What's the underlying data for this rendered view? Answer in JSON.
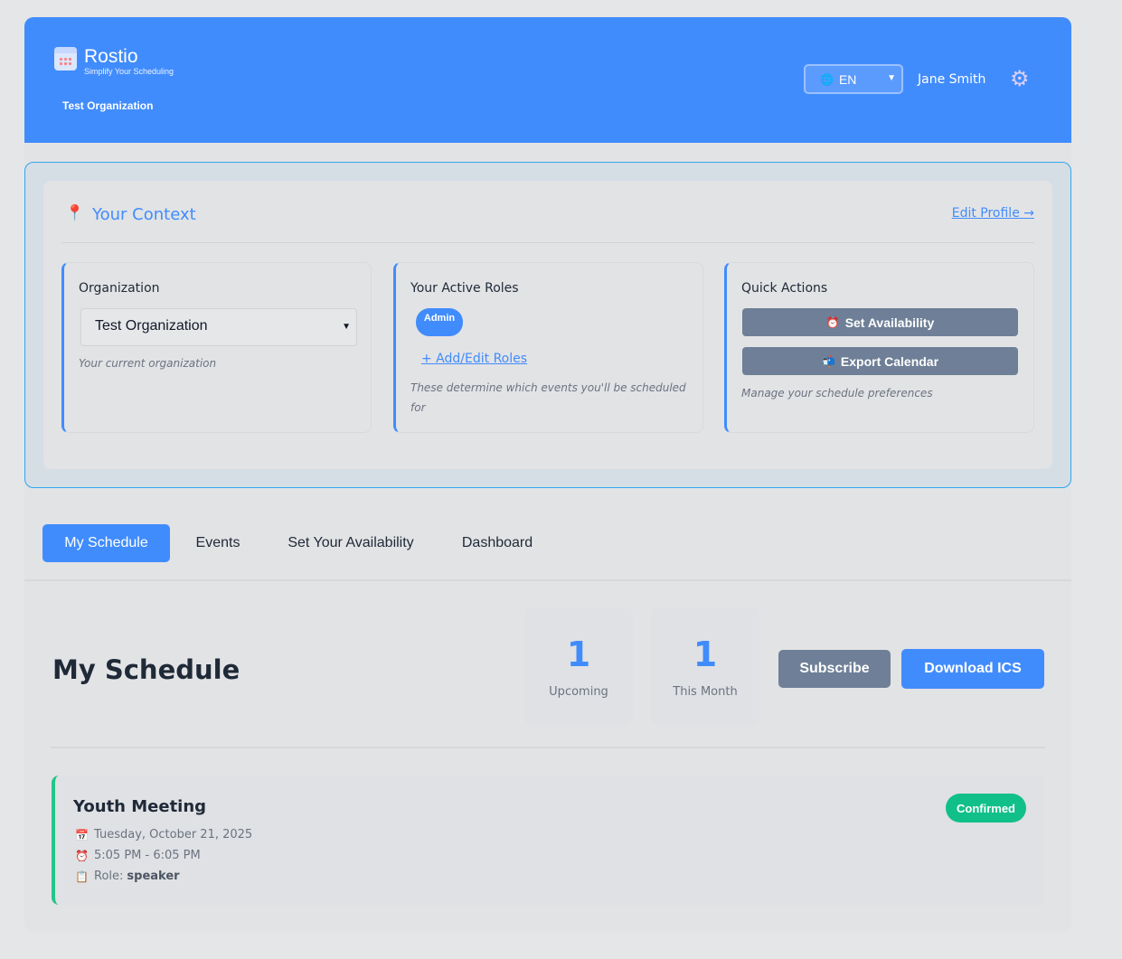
{
  "header": {
    "brand": "Rostio",
    "tagline": "Simplify Your Scheduling",
    "organization": "Test Organization",
    "language": "EN",
    "user_name": "Jane Smith"
  },
  "context": {
    "title": "Your Context",
    "edit_profile": "Edit Profile →",
    "organization_card": {
      "label": "Organization",
      "selected": "Test Organization",
      "note": "Your current organization"
    },
    "roles_card": {
      "label": "Your Active Roles",
      "roles": [
        "Admin"
      ],
      "edit_link": "+ Add/Edit Roles",
      "note_line1": "These determine which events you'll be scheduled",
      "note_line2": "for"
    },
    "quick_actions": {
      "label": "Quick Actions",
      "set_availability": "Set Availability",
      "export_calendar": "Export Calendar",
      "note": "Manage your schedule preferences"
    }
  },
  "tabs": [
    "My Schedule",
    "Events",
    "Set Your Availability",
    "Dashboard"
  ],
  "schedule": {
    "title": "My Schedule",
    "stats": [
      {
        "value": "1",
        "label": "Upcoming"
      },
      {
        "value": "1",
        "label": "This Month"
      }
    ],
    "subscribe_label": "Subscribe",
    "download_label": "Download ICS",
    "events": [
      {
        "title": "Youth Meeting",
        "date": "Tuesday, October 21, 2025",
        "time": "5:05 PM - 6:05 PM",
        "role_label": "Role:",
        "role": "speaker",
        "status": "Confirmed"
      }
    ]
  },
  "colors": {
    "primary": "#418cfd",
    "secondary_button": "#6e7f97",
    "confirmed": "#11c088",
    "event_accent": "#22c58a"
  }
}
